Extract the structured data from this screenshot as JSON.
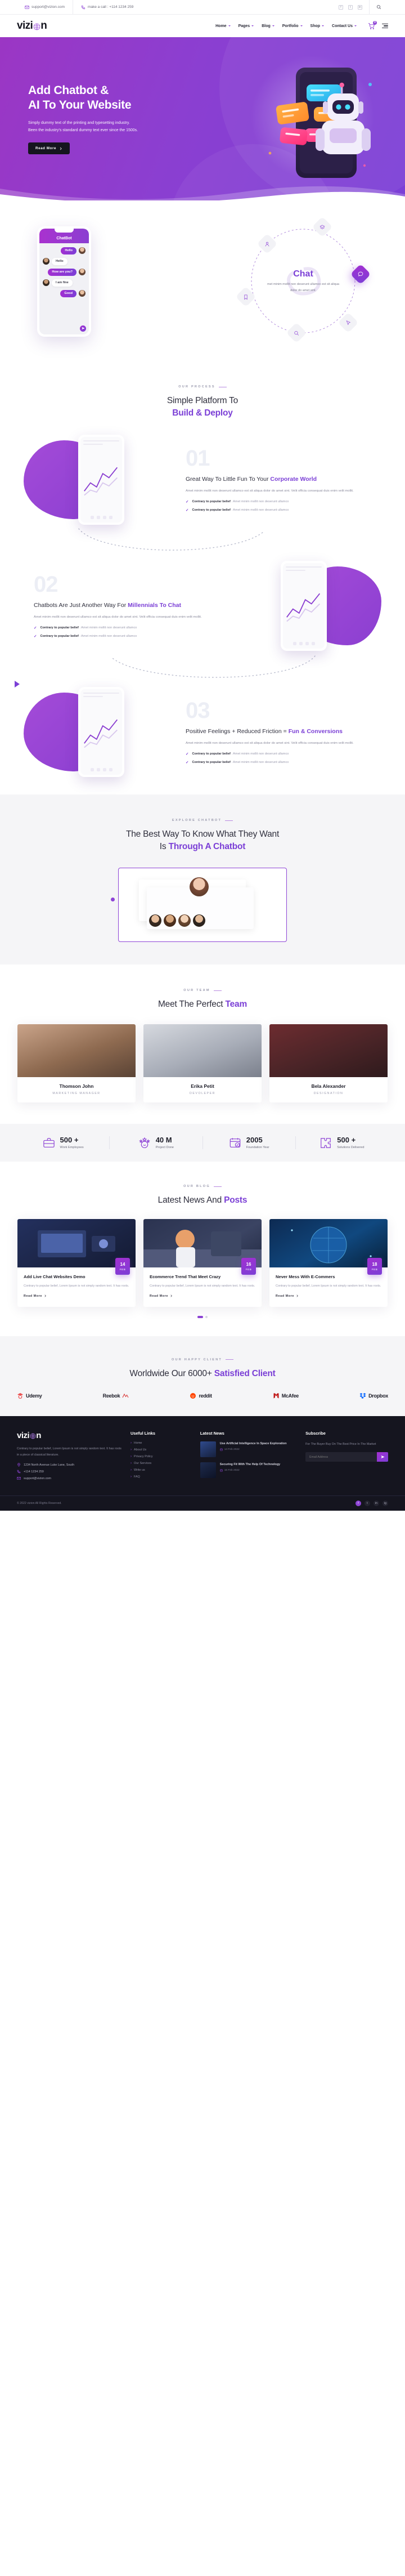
{
  "topbar": {
    "email": "support@vizion.com",
    "phone": "make a call : +114 1234 259",
    "email_icon": "envelope-icon",
    "phone_icon": "phone-icon",
    "socials": [
      "facebook-icon",
      "twitter-icon",
      "linkedin-icon"
    ],
    "search_icon": "search-icon"
  },
  "nav": {
    "logo": "vizi",
    "logo_tail": "n",
    "items": [
      {
        "label": "Home"
      },
      {
        "label": "Pages"
      },
      {
        "label": "Blog"
      },
      {
        "label": "Portfolio"
      },
      {
        "label": "Shop"
      },
      {
        "label": "Contact Us"
      }
    ],
    "cart_count": "0"
  },
  "hero": {
    "title_line1": "Add Chatbot &",
    "title_line2": "AI To Your Website",
    "para_line1": "Simply dummy text of the printing and typesetting industry.",
    "para_line2": "Been the industry's standard dummy text ever since the 1500s.",
    "cta": "Read More"
  },
  "showcase": {
    "phone_title": "ChatBot",
    "messages": [
      {
        "text": "Hello",
        "side": "me"
      },
      {
        "text": "Hello",
        "side": "them"
      },
      {
        "text": "How are you?",
        "side": "me"
      },
      {
        "text": "I am fine",
        "side": "them"
      },
      {
        "text": "Good",
        "side": "me"
      }
    ],
    "orbit_title": "Chat",
    "orbit_text": "met minim mollit non deserunt ullamco est sit aliqua dolor do amet sint.",
    "orbit_nodes": [
      "layers-icon",
      "user-icon",
      "bookmark-icon",
      "chat-bubble-icon",
      "cursor-click-icon",
      "search-circle-icon"
    ]
  },
  "process": {
    "eyebrow": "OUR PROCESS",
    "title_top": "Simple Platform To",
    "title_bottom": "Build & Deploy",
    "steps": [
      {
        "num": "01",
        "heading_plain": "Great Way To Little Fun To Your ",
        "heading_accent": "Corporate World",
        "para": "Amet minim mollit non deserunt ullamco est sit aliqua dolor do amet sint. Velit officia consequat duis enim velit mollit.",
        "ticks": [
          {
            "bold": "Contrary to popular belief",
            "rest": " : Amet minim mollit non deserunt ullamco"
          },
          {
            "bold": "Contrary to popular belief",
            "rest": " : Amet minim mollit non deserunt ullamco"
          }
        ]
      },
      {
        "num": "02",
        "heading_plain": "Chatbots Are Just Another Way For ",
        "heading_accent": "Millennials To Chat",
        "para": "Amet minim mollit non deserunt ullamco est sit aliqua dolor do amet sint. Velit officia consequat duis enim velit mollit.",
        "ticks": [
          {
            "bold": "Contrary to popular belief",
            "rest": " : Amet minim mollit non deserunt ullamco"
          },
          {
            "bold": "Contrary to popular belief",
            "rest": " : Amet minim mollit non deserunt ullamco"
          }
        ]
      },
      {
        "num": "03",
        "heading_plain": "Positive Feelings + Reduced Friction = ",
        "heading_accent": "Fun & Conversions",
        "para": "Amet minim mollit non deserunt ullamco est sit aliqua dolor do amet sint. Velit officia consequat duis enim velit mollit.",
        "ticks": [
          {
            "bold": "Contrary to popular belief",
            "rest": " : Amet minim mollit non deserunt ullamco"
          },
          {
            "bold": "Contrary to popular belief",
            "rest": " : Amet minim mollit non deserunt ullamco"
          }
        ]
      }
    ]
  },
  "explore": {
    "eyebrow": "EXPLORE CHATBOT",
    "title_top": "The Best Way To Know What They Want",
    "title_bottom_plain": "Is ",
    "title_bottom_accent": "Through A Chatbot"
  },
  "team": {
    "eyebrow": "OUR TEAM",
    "title_plain": "Meet The Perfect ",
    "title_accent": "Team",
    "members": [
      {
        "name": "Thomson John",
        "role": "MARKETING MANAGER"
      },
      {
        "name": "Erika Petit",
        "role": "DEVOLEPER"
      },
      {
        "name": "Bela Alexander",
        "role": "DESIGNATION"
      }
    ]
  },
  "stats": [
    {
      "icon": "briefcase-icon",
      "value": "500 +",
      "label": "Work Employees"
    },
    {
      "icon": "smiley-star-icon",
      "value": "40 M",
      "label": "Project Done"
    },
    {
      "icon": "calendar-check-icon",
      "value": "2005",
      "label": "Foundation Year"
    },
    {
      "icon": "puzzle-icon",
      "value": "500 +",
      "label": "Solutions Delivered"
    }
  ],
  "blog": {
    "eyebrow": "OUR BLOG",
    "title_plain": "Latest News And ",
    "title_accent": "Posts",
    "posts": [
      {
        "day": "14",
        "month": "FEB",
        "title": "Add Live Chat Websites Demo",
        "excerpt": "Contrary to popular belief, Lorem Ipsum is not simply random text. It has roots.",
        "more": "Read More"
      },
      {
        "day": "16",
        "month": "FEB",
        "title": "Ecommerce Trend That Meet Crazy",
        "excerpt": "Contrary to popular belief, Lorem Ipsum is not simply random text. It has roots.",
        "more": "Read More"
      },
      {
        "day": "18",
        "month": "FEB",
        "title": "Never Mess With E-Commers",
        "excerpt": "Contrary to popular belief, Lorem Ipsum is not simply random text. It has roots.",
        "more": "Read More"
      }
    ]
  },
  "clients": {
    "eyebrow": "OUR HAPPY CLIENT",
    "title_plain": "Worldwide Our 6000+ ",
    "title_accent": "Satisfied Client",
    "logos": [
      {
        "name": "Udemy",
        "mark": "udemy-mark",
        "color": "#ec5252"
      },
      {
        "name": "Reebok",
        "mark": "reebok-mark",
        "color": "#1d1d28"
      },
      {
        "name": "reddit",
        "mark": "reddit-mark",
        "color": "#ff4500"
      },
      {
        "name": "McAfee",
        "mark": "mcafee-mark",
        "color": "#c01818"
      },
      {
        "name": "Dropbox",
        "mark": "dropbox-mark",
        "color": "#1d1d28"
      }
    ]
  },
  "footer": {
    "logo": "vizi",
    "logo_tail": "n",
    "about": "Contrary to popular belief, Lorem Ipsum is not simply random text. It has roots in a piece of classical literature.",
    "contacts": [
      {
        "icon": "location-icon",
        "text": "1234 North Avenue Luke Lane, South"
      },
      {
        "icon": "phone-icon",
        "text": "+114 1234 259"
      },
      {
        "icon": "envelope-icon",
        "text": "support@vizion.com"
      }
    ],
    "links_title": "Useful Links",
    "links": [
      "Home",
      "About Us",
      "Privacy Policy",
      "Our Services",
      "Write us",
      "FAQ"
    ],
    "news_title": "Latest News",
    "news": [
      {
        "title": "Use Artificial Intelligence In Space Exploration",
        "date": "14 Feb 2022"
      },
      {
        "title": "Securing Fit With The Help Of Technology",
        "date": "16 Feb 2022"
      }
    ],
    "sub_title": "Subscribe",
    "sub_text": "For The Buyer Buy On The Best Price In The Market",
    "sub_placeholder": "Email Address",
    "copyright": "© 2022 vizion All Rights Reserved.",
    "socials": [
      "facebook-icon",
      "twitter-icon",
      "linkedin-icon",
      "instagram-icon"
    ]
  }
}
